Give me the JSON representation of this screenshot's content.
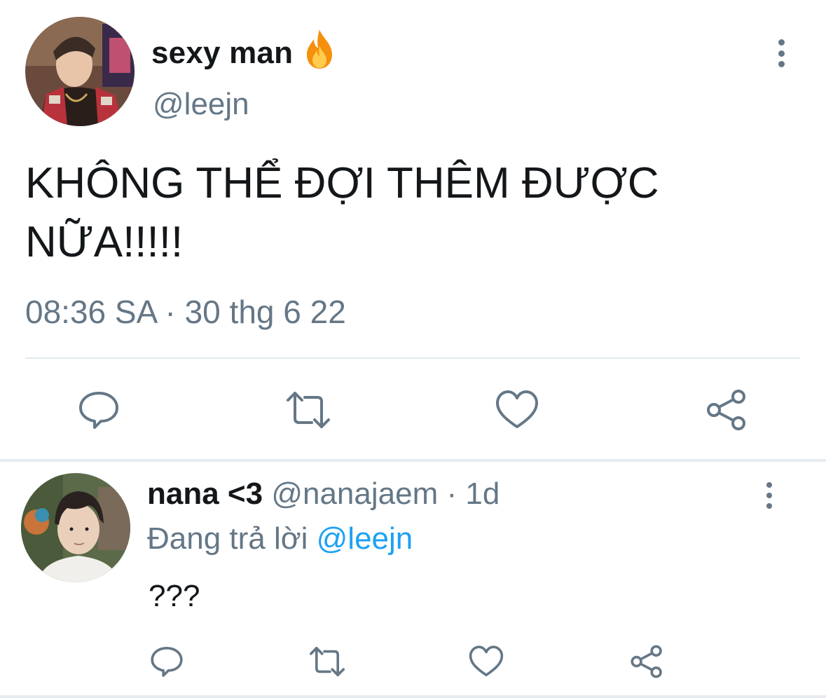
{
  "main_tweet": {
    "display_name": "sexy man",
    "name_emoji": "fire-emoji",
    "handle": "@leejn",
    "text_line1": "KHÔNG THỂ ĐỢI THÊM ĐƯỢC",
    "text_line2": "NỮA!!!!!",
    "timestamp": "08:36 SA · 30 thg 6 22",
    "actions": [
      "reply-icon",
      "retweet-icon",
      "like-icon",
      "share-icon"
    ]
  },
  "reply": {
    "display_name": "nana <3",
    "handle": "@nanajaem",
    "separator": "·",
    "time": "1d",
    "replying_to_label": "Đang trả lời",
    "replying_to_handle": "@leejn",
    "text": "???",
    "actions": [
      "reply-icon",
      "retweet-icon",
      "like-icon",
      "share-icon"
    ]
  },
  "colors": {
    "text_primary": "#14171a",
    "text_secondary": "#657786",
    "link": "#1da1f2",
    "divider": "#e1e8ed"
  }
}
